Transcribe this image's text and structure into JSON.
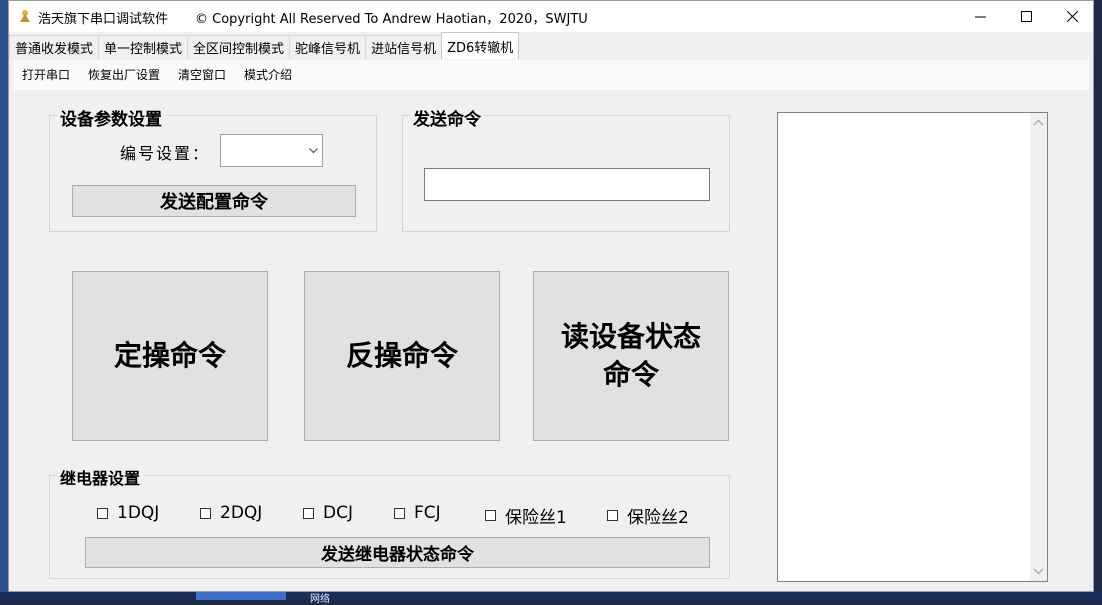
{
  "window": {
    "app_name": "浩天旗下串口调试软件",
    "copyright": "© Copyright All Reserved To Andrew Haotian，2020，SWJTU"
  },
  "tabs": [
    {
      "label": "普通收发模式",
      "active": false
    },
    {
      "label": "单一控制模式",
      "active": false
    },
    {
      "label": "全区间控制模式",
      "active": false
    },
    {
      "label": "驼峰信号机",
      "active": false
    },
    {
      "label": "进站信号机",
      "active": false
    },
    {
      "label": "ZD6转辙机",
      "active": true
    }
  ],
  "menu": [
    "打开串口",
    "恢复出厂设置",
    "清空窗口",
    "模式介绍"
  ],
  "device_params": {
    "title": "设备参数设置",
    "number_label": "编号设置：",
    "number_value": "",
    "send_config_button": "发送配置命令"
  },
  "send_command": {
    "title": "发送命令",
    "input_value": ""
  },
  "big_buttons": {
    "fixed": "定操命令",
    "reverse": "反操命令",
    "read_status_line1": "读设备状态",
    "read_status_line2": "命令"
  },
  "relay": {
    "title": "继电器设置",
    "checkboxes": [
      {
        "label": "1DQJ",
        "checked": false
      },
      {
        "label": "2DQJ",
        "checked": false
      },
      {
        "label": "DCJ",
        "checked": false
      },
      {
        "label": "FCJ",
        "checked": false
      },
      {
        "label": "保险丝1",
        "checked": false
      },
      {
        "label": "保险丝2",
        "checked": false
      }
    ],
    "send_button": "发送继电器状态命令"
  },
  "taskbar": {
    "network_label": "网络"
  },
  "colors": {
    "window_bg": "#f0f0f0",
    "button_bg": "#e1e1e1",
    "button_border": "#adadad"
  }
}
